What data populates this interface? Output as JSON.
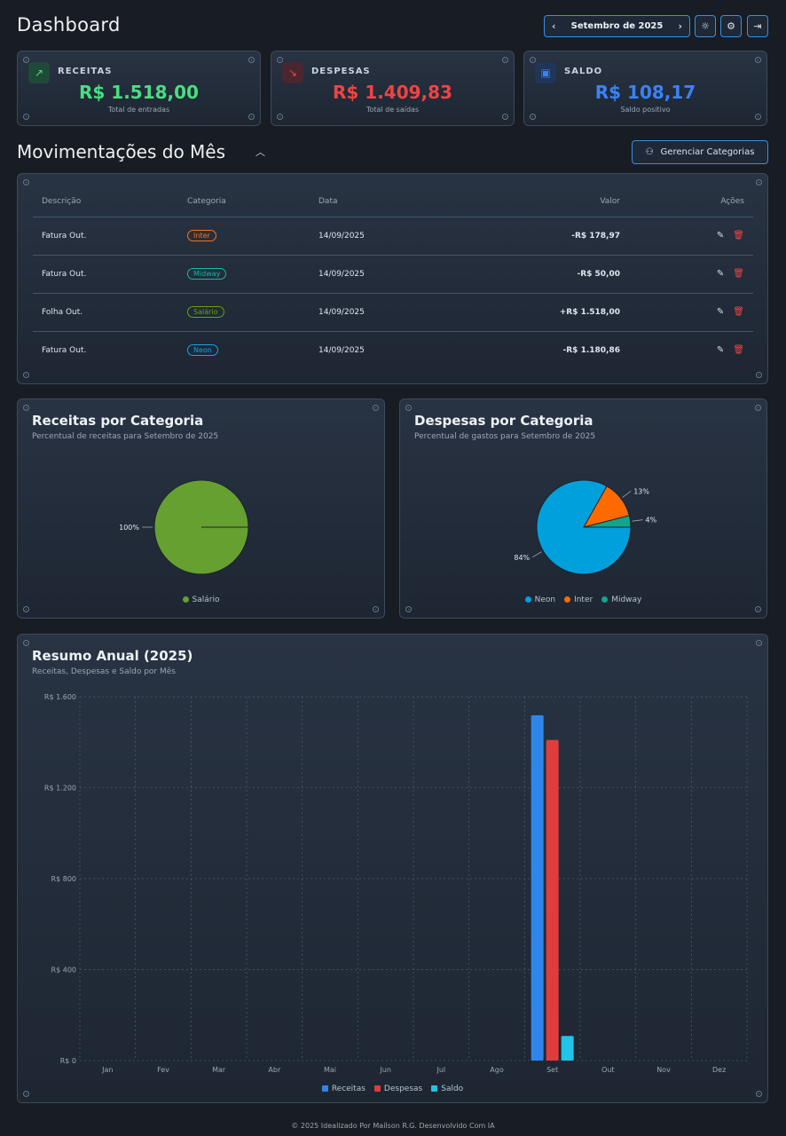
{
  "header": {
    "title": "Dashboard",
    "month": "Setembro de 2025",
    "prev_icon": "chevron-left-icon",
    "next_icon": "chevron-right-icon",
    "theme_icon": "sun-icon",
    "settings_icon": "gear-icon",
    "logout_icon": "logout-icon"
  },
  "cards": {
    "receitas": {
      "label": "RECEITAS",
      "value": "R$ 1.518,00",
      "sub": "Total de entradas",
      "color": "#4ade80",
      "icon": "trending-up-icon"
    },
    "despesas": {
      "label": "DESPESAS",
      "value": "R$ 1.409,83",
      "sub": "Total de saídas",
      "color": "#ef4444",
      "icon": "trending-down-icon"
    },
    "saldo": {
      "label": "SALDO",
      "value": "R$ 108,17",
      "sub": "Saldo positivo",
      "color": "#3b82f6",
      "icon": "wallet-icon"
    }
  },
  "movements": {
    "title": "Movimentações do Mês",
    "manage_label": "Gerenciar Categorias",
    "manage_icon": "categories-icon",
    "columns": [
      "Descrição",
      "Categoria",
      "Data",
      "Valor",
      "Ações"
    ],
    "rows": [
      {
        "desc": "Fatura Out.",
        "category": "Inter",
        "cat_color": "#f97316",
        "date": "14/09/2025",
        "value": "-R$ 178,97",
        "type": "neg"
      },
      {
        "desc": "Fatura Out.",
        "category": "Midway",
        "cat_color": "#14b8a6",
        "date": "14/09/2025",
        "value": "-R$ 50,00",
        "type": "neg"
      },
      {
        "desc": "Folha Out.",
        "category": "Salário",
        "cat_color": "#65a30d",
        "date": "14/09/2025",
        "value": "+R$ 1.518,00",
        "type": "pos"
      },
      {
        "desc": "Fatura Out.",
        "category": "Neon",
        "cat_color": "#0ea5e9",
        "date": "14/09/2025",
        "value": "-R$ 1.180,86",
        "type": "neg"
      }
    ]
  },
  "income_chart": {
    "title": "Receitas por Categoria",
    "subtitle": "Percentual de receitas para Setembro de 2025"
  },
  "expense_chart": {
    "title": "Despesas por Categoria",
    "subtitle": "Percentual de gastos para Setembro de 2025"
  },
  "annual_chart": {
    "title": "Resumo Anual (2025)",
    "subtitle": "Receitas, Despesas e Saldo por Mês"
  },
  "chart_data": [
    {
      "type": "pie",
      "title": "Receitas por Categoria",
      "slices": [
        {
          "name": "Salário",
          "value": 100,
          "label": "100%",
          "color": "#65a030"
        }
      ]
    },
    {
      "type": "pie",
      "title": "Despesas por Categoria",
      "slices": [
        {
          "name": "Neon",
          "value": 84,
          "label": "84%",
          "color": "#00a0dc"
        },
        {
          "name": "Inter",
          "value": 13,
          "label": "13%",
          "color": "#ff6a00"
        },
        {
          "name": "Midway",
          "value": 4,
          "label": "4%",
          "color": "#12a58c"
        }
      ]
    },
    {
      "type": "bar",
      "title": "Resumo Anual (2025)",
      "categories": [
        "Jan",
        "Fev",
        "Mar",
        "Abr",
        "Mai",
        "Jun",
        "Jul",
        "Ago",
        "Set",
        "Out",
        "Nov",
        "Dez"
      ],
      "ylim": [
        0,
        1600
      ],
      "yticks": [
        0,
        400,
        800,
        1200,
        1600
      ],
      "ytick_labels": [
        "R$ 0",
        "R$ 400",
        "R$ 800",
        "R$ 1.200",
        "R$ 1.600"
      ],
      "grid": true,
      "legend": "bottom",
      "series": [
        {
          "name": "Receitas",
          "color": "#2f86ea",
          "values": [
            0,
            0,
            0,
            0,
            0,
            0,
            0,
            0,
            1518,
            0,
            0,
            0
          ]
        },
        {
          "name": "Despesas",
          "color": "#e03c3c",
          "values": [
            0,
            0,
            0,
            0,
            0,
            0,
            0,
            0,
            1409.83,
            0,
            0,
            0
          ]
        },
        {
          "name": "Saldo",
          "color": "#22c3e6",
          "values": [
            0,
            0,
            0,
            0,
            0,
            0,
            0,
            0,
            108.17,
            0,
            0,
            0
          ]
        }
      ]
    }
  ],
  "footer": "© 2025 Idealizado Por Maílson R.G. Desenvolvido Com IA"
}
